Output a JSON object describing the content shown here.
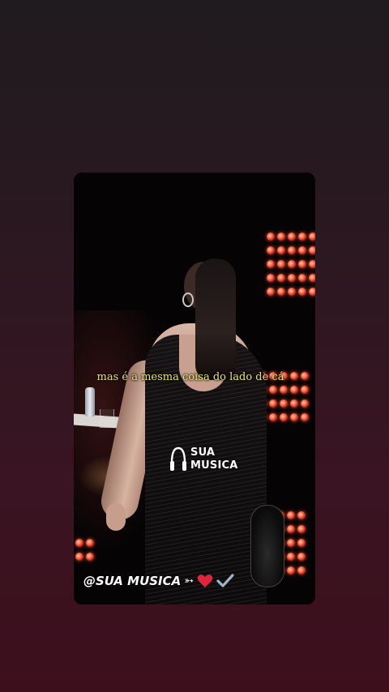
{
  "story": {
    "lyrics": "mas é a mesma coisa do lado de cá",
    "watermark": {
      "line1": "SUA",
      "line2": "MUSICA",
      "icon": "headphones-icon"
    },
    "handle": "@SUA MUSICA",
    "arrow_glyph": "➳",
    "emojis": [
      "heart-icon",
      "check-icon"
    ]
  },
  "colors": {
    "lyrics": "#e8e07a",
    "heart": "#e0243a",
    "check": "#9fb3c8",
    "stage_lights": "#ff6a4a"
  }
}
